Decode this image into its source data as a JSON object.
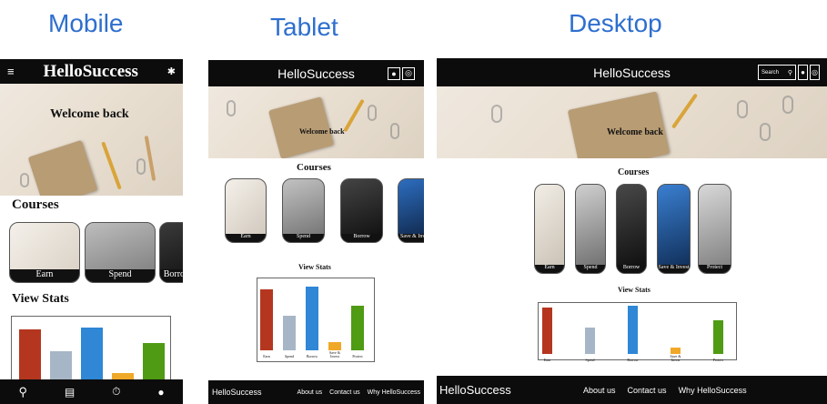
{
  "captions": {
    "mobile": "Mobile",
    "tablet": "Tablet",
    "desktop": "Desktop"
  },
  "brand": "HelloSuccess",
  "hero_text": "Welcome back",
  "courses_heading": "Courses",
  "stats_heading": "View Stats",
  "search_placeholder": "Search",
  "courses": [
    "Earn",
    "Spend",
    "Borrow",
    "Save & Invest",
    "Protect"
  ],
  "footer_links": [
    "About us",
    "Contact us",
    "Why HelloSuccess"
  ],
  "chart_data": {
    "type": "bar",
    "categories": [
      "Earn",
      "Spend",
      "Borrow",
      "Save & Invest",
      "Protect"
    ],
    "values": [
      88,
      50,
      92,
      12,
      64
    ],
    "colors": [
      "#b5361f",
      "#a6b6c6",
      "#2f87d6",
      "#f0a828",
      "#4f9b13"
    ],
    "ylim": [
      0,
      100
    ]
  },
  "icons": {
    "menu": "menu-icon",
    "settings": "gear-icon",
    "user": "user-icon",
    "globe": "globe-icon",
    "search": "search-icon",
    "book": "book-icon",
    "timer": "timer-icon"
  }
}
